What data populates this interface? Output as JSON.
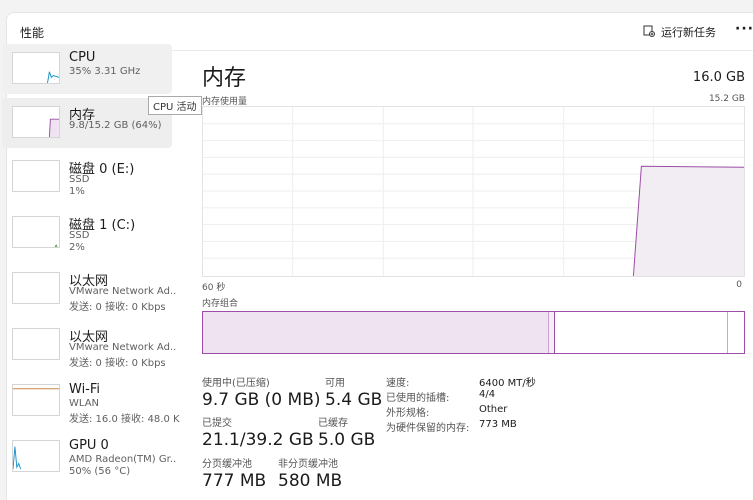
{
  "header": {
    "title": "性能",
    "run_task": "运行新任务",
    "more": "···"
  },
  "tooltip": "CPU 活动",
  "sidebar": [
    {
      "name": "CPU",
      "line1": "35% 3.31 GHz",
      "line2": "",
      "color": "#1a92c9"
    },
    {
      "name": "内存",
      "line1": "9.8/15.2 GB (64%)",
      "line2": "",
      "color": "#9b4ea6"
    },
    {
      "name": "磁盘 0 (E:)",
      "line1": "SSD",
      "line2": "1%",
      "color": "#4b9c3a"
    },
    {
      "name": "磁盘 1 (C:)",
      "line1": "SSD",
      "line2": "2%",
      "color": "#4b9c3a"
    },
    {
      "name": "以太网",
      "line1": "VMware Network Ad..",
      "line2": "发送: 0 接收: 0 Kbps",
      "color": "#c8894a"
    },
    {
      "name": "以太网",
      "line1": "VMware Network Ad..",
      "line2": "发送: 0 接收: 0 Kbps",
      "color": "#c8894a"
    },
    {
      "name": "Wi-Fi",
      "line1": "WLAN",
      "line2": "发送: 16.0 接收: 48.0 K",
      "color": "#c8894a"
    },
    {
      "name": "GPU 0",
      "line1": "AMD Radeon(TM) Gr..",
      "line2": "50% (56 °C)",
      "color": "#1a92c9"
    }
  ],
  "main": {
    "title": "内存",
    "total": "16.0 GB",
    "usage_label": "内存使用量",
    "usage_max": "15.2 GB",
    "axis_left": "60 秒",
    "axis_right": "0",
    "composition_label": "内存组合",
    "composition": {
      "in_use_fraction": 0.64,
      "modified_fraction": 0.01,
      "standby_fraction": 0.32
    }
  },
  "stats": {
    "in_use_label": "使用中(已压缩)",
    "in_use_value": "9.7 GB (0 MB)",
    "available_label": "可用",
    "available_value": "5.4 GB",
    "committed_label": "已提交",
    "committed_value": "21.1/39.2 GB",
    "cached_label": "已缓存",
    "cached_value": "5.0 GB",
    "paged_label": "分页缓冲池",
    "paged_value": "777 MB",
    "nonpaged_label": "非分页缓冲池",
    "nonpaged_value": "580 MB"
  },
  "details": [
    {
      "key": "速度:",
      "value": "6400 MT/秒"
    },
    {
      "key": "已使用的插槽:",
      "value": "4/4"
    },
    {
      "key": "外形规格:",
      "value": "Other"
    },
    {
      "key": "为硬件保留的内存:",
      "value": "773 MB"
    }
  ],
  "accent_color": "#9b4ea6"
}
